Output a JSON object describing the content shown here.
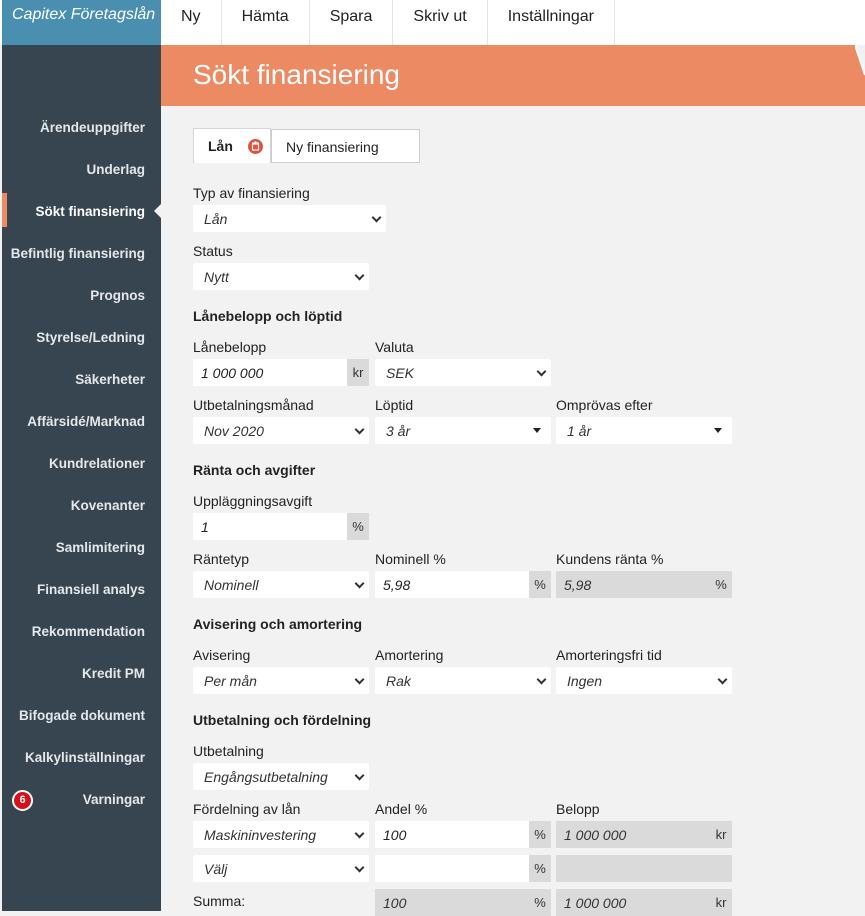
{
  "app": {
    "title": "Capitex Företagslån"
  },
  "menu": [
    "Ny",
    "Hämta",
    "Spara",
    "Skriv ut",
    "Inställningar"
  ],
  "sidebar": {
    "items": [
      "Ärendeuppgifter",
      "Underlag",
      "Sökt finansiering",
      "Befintlig finansiering",
      "Prognos",
      "Styrelse/Ledning",
      "Säkerheter",
      "Affärsidé/Marknad",
      "Kundrelationer",
      "Kovenanter",
      "Samlimitering",
      "Finansiell analys",
      "Rekommendation",
      "Kredit PM",
      "Bifogade dokument",
      "Kalkylinställningar",
      "Varningar"
    ],
    "active_index": 2,
    "warning_count": "6"
  },
  "page": {
    "title": "Sökt finansiering"
  },
  "tab": {
    "label": "Lån",
    "name_value": "Ny finansiering"
  },
  "form": {
    "typ_label": "Typ av finansiering",
    "typ_value": "Lån",
    "status_label": "Status",
    "status_value": "Nytt",
    "sec1_heading": "Lånebelopp och löptid",
    "belopp_label": "Lånebelopp",
    "belopp_value": "1 000 000",
    "belopp_unit": "kr",
    "valuta_label": "Valuta",
    "valuta_value": "SEK",
    "utbet_manad_label": "Utbetalningsmånad",
    "utbet_manad_value": "Nov 2020",
    "loptid_label": "Löptid",
    "loptid_value": "3 år",
    "omprovas_label": "Omprövas efter",
    "omprovas_value": "1 år",
    "sec2_heading": "Ränta och avgifter",
    "avgift_label": "Uppläggningsavgift",
    "avgift_value": "1",
    "avgift_unit": "%",
    "rantetyp_label": "Räntetyp",
    "rantetyp_value": "Nominell",
    "nominell_label": "Nominell %",
    "nominell_value": "5,98",
    "nominell_unit": "%",
    "kundranta_label": "Kundens ränta %",
    "kundranta_value": "5,98",
    "kundranta_unit": "%",
    "sec3_heading": "Avisering och amortering",
    "avisering_label": "Avisering",
    "avisering_value": "Per mån",
    "amortering_label": "Amortering",
    "amortering_value": "Rak",
    "amortfri_label": "Amorteringsfri tid",
    "amortfri_value": "Ingen",
    "sec4_heading": "Utbetalning och fördelning",
    "utbetalning_label": "Utbetalning",
    "utbetalning_value": "Engångsutbetalning",
    "fordelning_label": "Fördelning av lån",
    "andel_label": "Andel %",
    "belopp2_label": "Belopp",
    "row1_select": "Maskininvestering",
    "row1_andel": "100",
    "row1_andel_unit": "%",
    "row1_belopp": "1 000 000",
    "row1_belopp_unit": "kr",
    "row2_select": "Välj",
    "row2_andel": "",
    "row2_andel_unit": "%",
    "row2_belopp": "",
    "summa_label": "Summa:",
    "summa_andel": "100",
    "summa_andel_unit": "%",
    "summa_belopp": "1 000 000",
    "summa_belopp_unit": "kr"
  },
  "colors": {
    "accent": "#ec8a63",
    "sidebar": "#364550",
    "logo": "#4a8faf",
    "badge": "#d9101a"
  }
}
